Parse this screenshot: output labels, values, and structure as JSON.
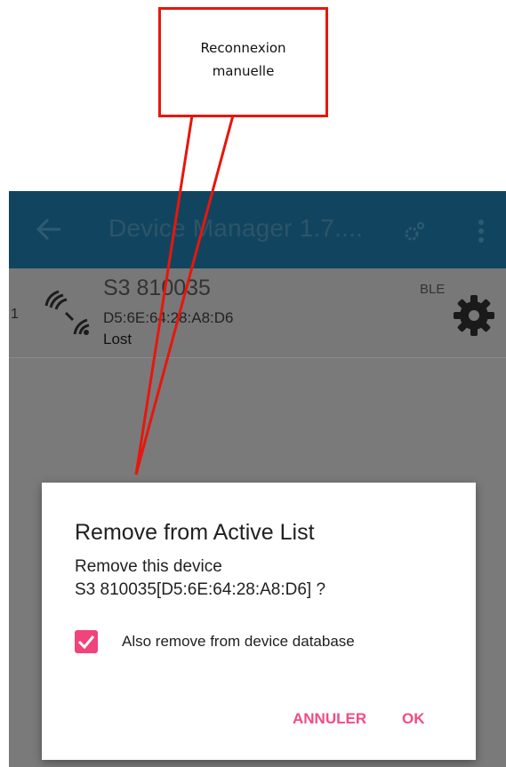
{
  "annotation": {
    "callout_line1": "Reconnexion",
    "callout_line2": "manuelle",
    "color": "#e8160c"
  },
  "toolbar": {
    "title": "Device Manager 1.7....",
    "back_icon": "arrow-left-icon",
    "settings_icon": "gear-icon",
    "menu_icon": "overflow-menu-icon",
    "color": "#11455f"
  },
  "device": {
    "index": "1",
    "name": "S3 810035",
    "mac": "D5:6E:64:28:A8:D6",
    "status": "Lost",
    "type": "BLE",
    "signal_icon": "wireless-signal-icon",
    "settings_icon": "gear-icon"
  },
  "dialog": {
    "title": "Remove from Active List",
    "message": "Remove this device\nS3 810035[D5:6E:64:28:A8:D6] ?",
    "checkbox_label": "Also remove from device database",
    "checkbox_checked": true,
    "cancel_label": "ANNULER",
    "ok_label": "OK",
    "accent_color": "#f0447b"
  }
}
